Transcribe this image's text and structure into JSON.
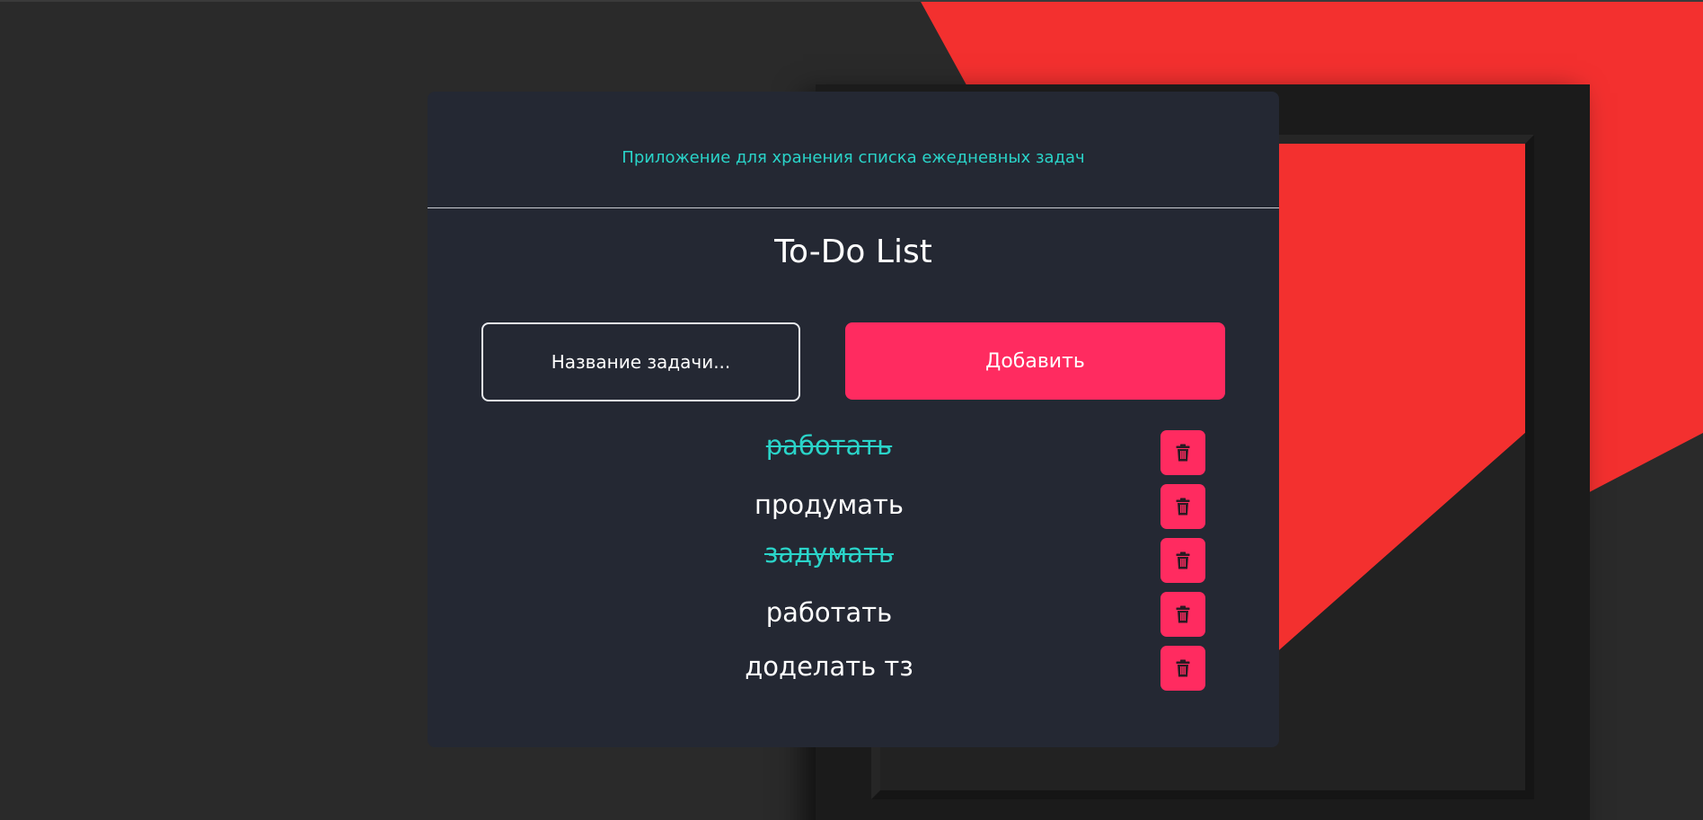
{
  "app": {
    "subtitle": "Приложение для хранения списка ежедневных задач",
    "title": "To-Do List"
  },
  "form": {
    "input_placeholder": "Название задачи...",
    "input_value": "",
    "add_label": "Добавить"
  },
  "tasks": [
    {
      "text": "работать",
      "done": true
    },
    {
      "text": "продумать",
      "done": false
    },
    {
      "text": "задумать",
      "done": true
    },
    {
      "text": "работать",
      "done": false
    },
    {
      "text": "доделать тз",
      "done": false
    }
  ],
  "icons": {
    "delete": "trash-icon"
  },
  "colors": {
    "accent": "#ff2b60",
    "teal": "#2ad4c9",
    "card_bg": "#242833",
    "background": "#2a2a2a",
    "background_red": "#f3302f"
  }
}
